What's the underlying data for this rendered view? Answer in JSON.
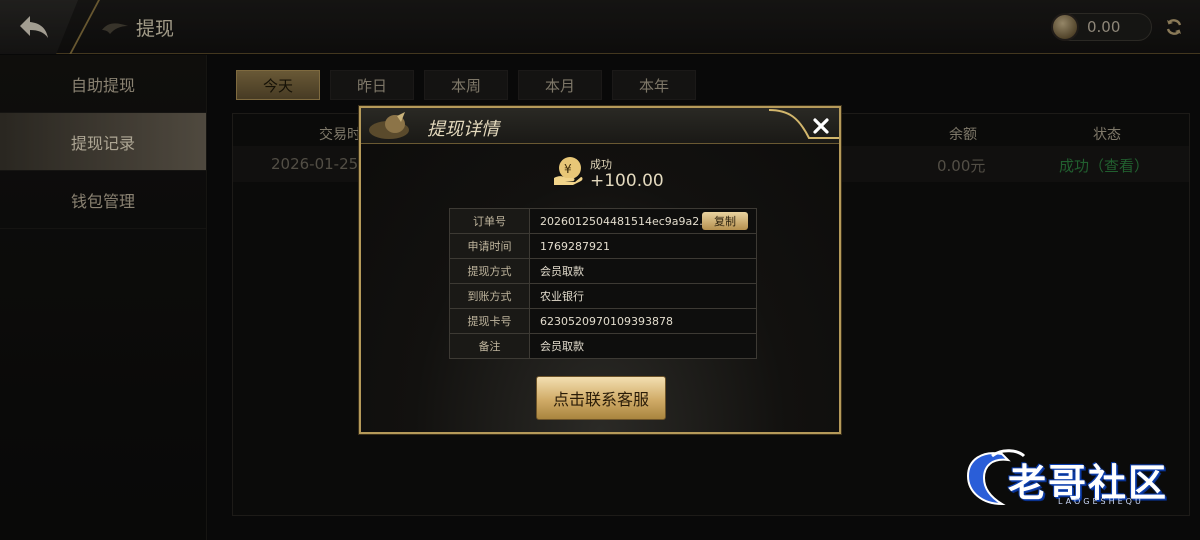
{
  "header": {
    "title": "提现",
    "balance": "0.00"
  },
  "sidebar": {
    "items": [
      {
        "label": "自助提现"
      },
      {
        "label": "提现记录"
      },
      {
        "label": "钱包管理"
      }
    ]
  },
  "tabs": [
    "今天",
    "昨日",
    "本周",
    "本月",
    "本年"
  ],
  "table": {
    "headers": {
      "time": "交易时",
      "balance": "余额",
      "status": "状态"
    },
    "row": {
      "date": "2026-01-25",
      "balance": "0.00元",
      "status": "成功（查看）"
    }
  },
  "modal": {
    "title": "提现详情",
    "status_label": "成功",
    "amount": "+100.00",
    "details": [
      {
        "key": "订单号",
        "value": "2026012504481514ec9a9a2..."
      },
      {
        "key": "申请时间",
        "value": "1769287921"
      },
      {
        "key": "提现方式",
        "value": "会员取款"
      },
      {
        "key": "到账方式",
        "value": "农业银行"
      },
      {
        "key": "提现卡号",
        "value": "6230520970109393878"
      },
      {
        "key": "备注",
        "value": "会员取款"
      }
    ],
    "copy_label": "复制",
    "contact_label": "点击联系客服"
  },
  "watermark": {
    "text": "老哥社区",
    "sub": "LAOGESHEQU"
  },
  "colors": {
    "accent_gold": "#b59a5a",
    "success_green": "#2d7f3f",
    "watermark_blue": "#0d3fae"
  }
}
